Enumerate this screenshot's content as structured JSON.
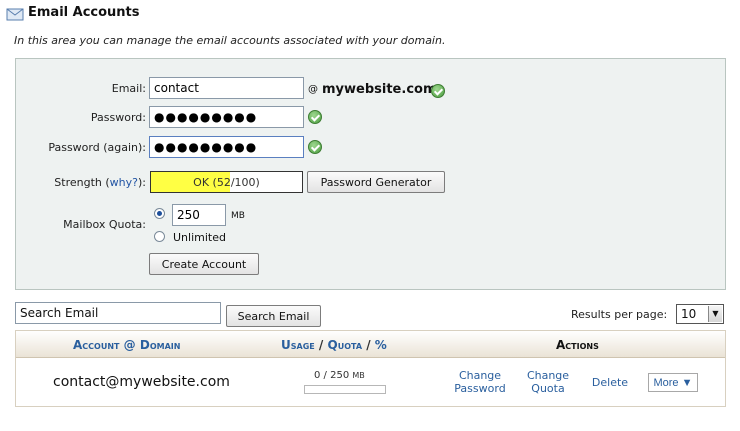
{
  "header": {
    "title": "Email Accounts",
    "description": "In this area you can manage the email accounts associated with your domain."
  },
  "form": {
    "email_label": "Email:",
    "email_value": "contact",
    "at_sign": "@",
    "domain": "mywebsite.com",
    "password_label": "Password:",
    "password_value": "●●●●●●●●●",
    "password_again_label": "Password (again):",
    "password_again_value": "●●●●●●●●●",
    "strength_label": "Strength (",
    "strength_why": "why?",
    "strength_label_end": "):",
    "strength_text": "OK (52/100)",
    "strength_score": 52,
    "strength_color": "#ffff44",
    "password_generator_button": "Password Generator",
    "quota_label": "Mailbox Quota:",
    "quota_value": "250",
    "quota_unit": "MB",
    "quota_unlimited": "Unlimited",
    "quota_selected": "value",
    "create_button": "Create Account"
  },
  "search": {
    "input_value": "Search Email",
    "button": "Search Email",
    "results_per_page_label": "Results per page:",
    "results_per_page_value": "10"
  },
  "table": {
    "header": {
      "account": "Account",
      "at": "@",
      "domain": "Domain",
      "usage": "Usage",
      "sep1": "/",
      "quota": "Quota",
      "sep2": "/",
      "percent": "%",
      "actions": "Actions"
    },
    "rows": [
      {
        "email": "contact@mywebsite.com",
        "usage": "0 / 250",
        "usage_unit": "MB",
        "usage_fraction": 0,
        "change_password_1": "Change",
        "change_password_2": "Password",
        "change_quota_1": "Change",
        "change_quota_2": "Quota",
        "delete": "Delete",
        "more": "More ▼"
      }
    ]
  },
  "colors": {
    "link": "#2a5f9e",
    "panel_bg": "#eef2f1",
    "check_green": "#4b9d3f"
  }
}
